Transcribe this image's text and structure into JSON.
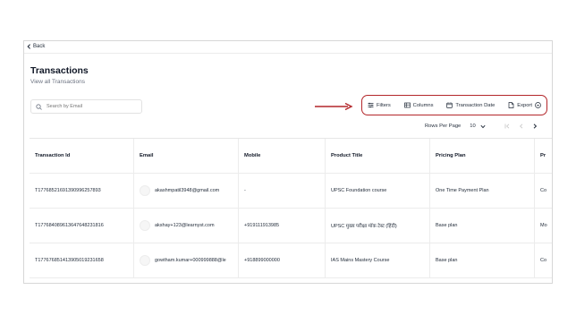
{
  "nav": {
    "back_label": "Back"
  },
  "page": {
    "title": "Transactions",
    "subtitle": "View all Transactions"
  },
  "search": {
    "placeholder": "Search by Email"
  },
  "toolbar": {
    "filters_label": "Filters",
    "columns_label": "Columns",
    "transaction_date_label": "Transaction Date",
    "export_label": "Export",
    "highlight_color": "#b3262a"
  },
  "pagination": {
    "rows_per_page_label": "Rows Per Page",
    "rows_per_page_value": "10"
  },
  "table": {
    "columns": [
      "Transaction Id",
      "Email",
      "Mobile",
      "Product Title",
      "Pricing Plan",
      "Pr"
    ],
    "rows": [
      {
        "transaction_id": "T17768521691390996257893",
        "email": "akashmpatil3948@gmail.com",
        "mobile": "-",
        "product_title": "UPSC Foundation course",
        "pricing_plan": "One Time Payment Plan",
        "partial": "Co"
      },
      {
        "transaction_id": "T17768408961364764823181​6",
        "email": "akshay+123@learnyst.com",
        "mobile": "+919111913985",
        "product_title": "UPSC मुख्य परीक्षा मॉक टेस्ट (हिंदी)",
        "pricing_plan": "Base plan",
        "partial": "Mo"
      },
      {
        "transaction_id": "T17767685141390501923165​8",
        "email": "gowtham.kumar+000999888@le",
        "mobile": "+918899000000",
        "product_title": "IAS Mains Mastery Course",
        "pricing_plan": "Base plan",
        "partial": "Co"
      }
    ]
  }
}
